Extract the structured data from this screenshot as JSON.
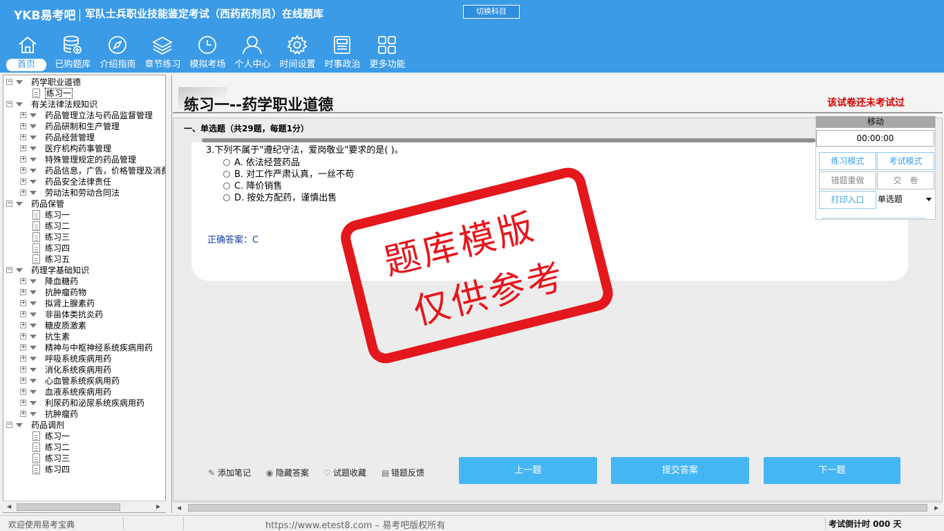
{
  "header": {
    "logo": "YKB易考吧",
    "title": "军队士兵职业技能鉴定考试（西药药剂员）在线题库",
    "switch_label": "切换科目",
    "nav": [
      {
        "label": "首页",
        "icon": "home-icon"
      },
      {
        "label": "已购题库",
        "icon": "database-icon"
      },
      {
        "label": "介绍指南",
        "icon": "compass-icon"
      },
      {
        "label": "章节练习",
        "icon": "layers-icon"
      },
      {
        "label": "模拟考场",
        "icon": "clock-icon"
      },
      {
        "label": "个人中心",
        "icon": "user-icon"
      },
      {
        "label": "时间设置",
        "icon": "gear-icon"
      },
      {
        "label": "时事政治",
        "icon": "newspaper-icon"
      },
      {
        "label": "更多功能",
        "icon": "grid-icon"
      }
    ]
  },
  "tree": {
    "nodes": [
      {
        "label": "药学职业道德",
        "level": 0,
        "exp": "−"
      },
      {
        "label": "练习一",
        "level": 1,
        "selected": true
      },
      {
        "label": "有关法律法规知识",
        "level": 0,
        "exp": "−"
      },
      {
        "label": "药品管理立法与药品监督管理",
        "level": 1,
        "exp": "+"
      },
      {
        "label": "药品研制和生产管理",
        "level": 1,
        "exp": "+"
      },
      {
        "label": "药品经营管理",
        "level": 1,
        "exp": "+"
      },
      {
        "label": "医疗机构药事管理",
        "level": 1,
        "exp": "+"
      },
      {
        "label": "特殊管理规定的药品管理",
        "level": 1,
        "exp": "+"
      },
      {
        "label": "药品信息，广告，价格管理及消费者权益保护",
        "level": 1,
        "exp": "+"
      },
      {
        "label": "药品安全法律责任",
        "level": 1,
        "exp": "+"
      },
      {
        "label": "劳动法和劳动合同法",
        "level": 1,
        "exp": "+"
      },
      {
        "label": "药品保管",
        "level": 0,
        "exp": "−"
      },
      {
        "label": "练习一",
        "level": 1
      },
      {
        "label": "练习二",
        "level": 1
      },
      {
        "label": "练习三",
        "level": 1
      },
      {
        "label": "练习四",
        "level": 1
      },
      {
        "label": "练习五",
        "level": 1
      },
      {
        "label": "药理学基础知识",
        "level": 0,
        "exp": "−"
      },
      {
        "label": "降血糖药",
        "level": 1,
        "exp": "+"
      },
      {
        "label": "抗肿瘤药物",
        "level": 1,
        "exp": "+"
      },
      {
        "label": "拟肾上腺素药",
        "level": 1,
        "exp": "+"
      },
      {
        "label": "非甾体类抗炎药",
        "level": 1,
        "exp": "+"
      },
      {
        "label": "糖皮质激素",
        "level": 1,
        "exp": "+"
      },
      {
        "label": "抗生素",
        "level": 1,
        "exp": "+"
      },
      {
        "label": "精神与中枢神经系统疾病用药",
        "level": 1,
        "exp": "+"
      },
      {
        "label": "呼吸系统疾病用药",
        "level": 1,
        "exp": "+"
      },
      {
        "label": "消化系统疾病用药",
        "level": 1,
        "exp": "+"
      },
      {
        "label": "心血管系统疾病用药",
        "level": 1,
        "exp": "+"
      },
      {
        "label": "血液系统疾病用药",
        "level": 1,
        "exp": "+"
      },
      {
        "label": "利尿药和泌尿系统疾病用药",
        "level": 1,
        "exp": "+"
      },
      {
        "label": "抗肿瘤药",
        "level": 1,
        "exp": "+"
      },
      {
        "label": "药品调剂",
        "level": 0,
        "exp": "−"
      },
      {
        "label": "练习一",
        "level": 1
      },
      {
        "label": "练习二",
        "level": 1
      },
      {
        "label": "练习三",
        "level": 1
      },
      {
        "label": "练习四",
        "level": 1
      }
    ]
  },
  "paper": {
    "title": "练习一--药学职业道德",
    "status": "该试卷还未考试过",
    "section": "一、单选题（共29题，每题1分）"
  },
  "question": {
    "text": "3.下列不属于\"遵纪守法，爱岗敬业\"要求的是( )。",
    "options": [
      "A. 依法经营药品",
      "B. 对工作严肃认真，一丝不苟",
      "C. 降价销售",
      "D. 按处方配药，谨慎出售"
    ],
    "answer": "正确答案：C"
  },
  "watermark": {
    "line1": "题库模版",
    "line2": "仅供参考"
  },
  "side_panel": {
    "move": "移动",
    "timer": "00:00:00",
    "practice_mode": "练习模式",
    "exam_mode": "考试模式",
    "redo_wrong": "错题重做",
    "submit_paper": "交　卷",
    "print": "打印入口",
    "type_select": "单选题"
  },
  "toolbar": {
    "add_note": "添加笔记",
    "hide_answer": "隐藏答案",
    "favorite": "试题收藏",
    "report": "错题反馈",
    "prev": "上一题",
    "submit": "提交答案",
    "next": "下一题"
  },
  "status": {
    "left": "欢迎使用易考宝典",
    "mid": "https://www.etest8.com – 易考吧版权所有",
    "right": "考试倒计时 000 天"
  },
  "colors": {
    "accent": "#3b9be6",
    "button": "#45b6f4",
    "stamp": "#e4171c",
    "status_red": "#d40000"
  }
}
